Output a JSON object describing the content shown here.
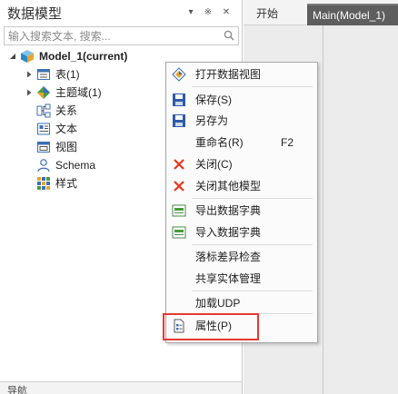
{
  "panel": {
    "title": "数据模型",
    "search_placeholder": "输入搜索文本, 搜索...",
    "header_buttons": [
      "pin-dropdown",
      "pin",
      "close"
    ]
  },
  "tree": {
    "root": {
      "label": "Model_1(current)",
      "icon": "model-cube-icon",
      "expanded": true
    },
    "items": [
      {
        "label": "表(1)",
        "icon": "table-icon",
        "expandable": true
      },
      {
        "label": "主题域(1)",
        "icon": "subject-area-icon",
        "expandable": true
      },
      {
        "label": "关系",
        "icon": "relation-icon",
        "expandable": false
      },
      {
        "label": "文本",
        "icon": "text-icon",
        "expandable": false
      },
      {
        "label": "视图",
        "icon": "view-icon",
        "expandable": false
      },
      {
        "label": "Schema",
        "icon": "schema-icon",
        "expandable": false
      },
      {
        "label": "样式",
        "icon": "style-icon",
        "expandable": false
      }
    ]
  },
  "tabs": [
    {
      "label": "开始",
      "active": false
    },
    {
      "label": "Main(Model_1)",
      "active": true
    }
  ],
  "context_menu": {
    "items": [
      {
        "label": "打开数据视图",
        "icon": "open-data-view-icon",
        "shortcut": ""
      },
      {
        "label": "保存(S)",
        "icon": "save-icon",
        "shortcut": ""
      },
      {
        "label": "另存为",
        "icon": "save-as-icon",
        "shortcut": ""
      },
      {
        "label": "重命名(R)",
        "icon": "",
        "shortcut": "F2"
      },
      {
        "label": "关闭(C)",
        "icon": "close-icon",
        "shortcut": ""
      },
      {
        "label": "关闭其他模型",
        "icon": "close-others-icon",
        "shortcut": ""
      },
      {
        "label": "导出数据字典",
        "icon": "export-dictionary-icon",
        "shortcut": ""
      },
      {
        "label": "导入数据字典",
        "icon": "import-dictionary-icon",
        "shortcut": ""
      },
      {
        "label": "落标差异检查",
        "icon": "",
        "shortcut": ""
      },
      {
        "label": "共享实体管理",
        "icon": "",
        "shortcut": ""
      },
      {
        "label": "加载UDP",
        "icon": "",
        "shortcut": ""
      },
      {
        "label": "属性(P)",
        "icon": "properties-icon",
        "shortcut": "",
        "highlighted": true
      }
    ]
  },
  "bottom": {
    "label": "导航"
  },
  "colors": {
    "active_tab_bg": "#5e5e5e",
    "highlight_border": "#e53935",
    "save_blue": "#2f5aa8",
    "close_red": "#e8341c"
  }
}
